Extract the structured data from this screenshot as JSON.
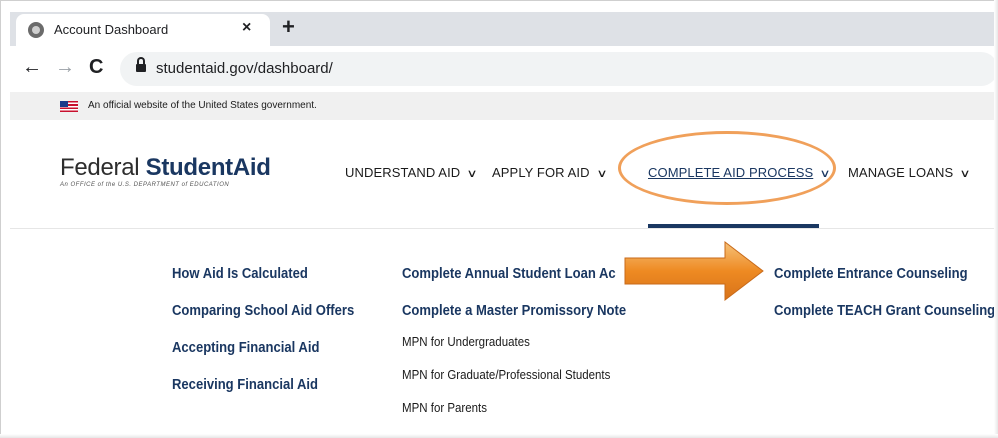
{
  "browser": {
    "tab_title": "Account Dashboard",
    "tab_close": "×",
    "new_tab": "+",
    "back": "←",
    "forward": "→",
    "reload": "C",
    "url": "studentaid.gov/dashboard/"
  },
  "gov_banner": {
    "text": "An official website of the United States government."
  },
  "logo": {
    "word1": "Federal ",
    "word2": "Student",
    "word3": "Aid",
    "tagline": "An OFFICE of the U.S. DEPARTMENT of EDUCATION"
  },
  "nav": {
    "understand": "UNDERSTAND AID",
    "apply": "APPLY FOR AID",
    "complete": "COMPLETE AID PROCESS",
    "manage": "MANAGE LOANS",
    "chevron": "∨"
  },
  "menu": {
    "col1": [
      "How Aid Is Calculated",
      "Comparing School Aid Offers",
      "Accepting Financial Aid",
      "Receiving Financial Aid"
    ],
    "col2_links": [
      "Complete Annual Student Loan Ac",
      "Complete a Master Promissory Note"
    ],
    "col2_sub": [
      "MPN for Undergraduates",
      "MPN for Graduate/Professional Students",
      "MPN for Parents"
    ],
    "col3": [
      "Complete Entrance Counseling",
      "Complete TEACH Grant Counseling"
    ]
  },
  "colors": {
    "brand_navy": "#1a3761",
    "callout_orange": "#f0a05a"
  }
}
